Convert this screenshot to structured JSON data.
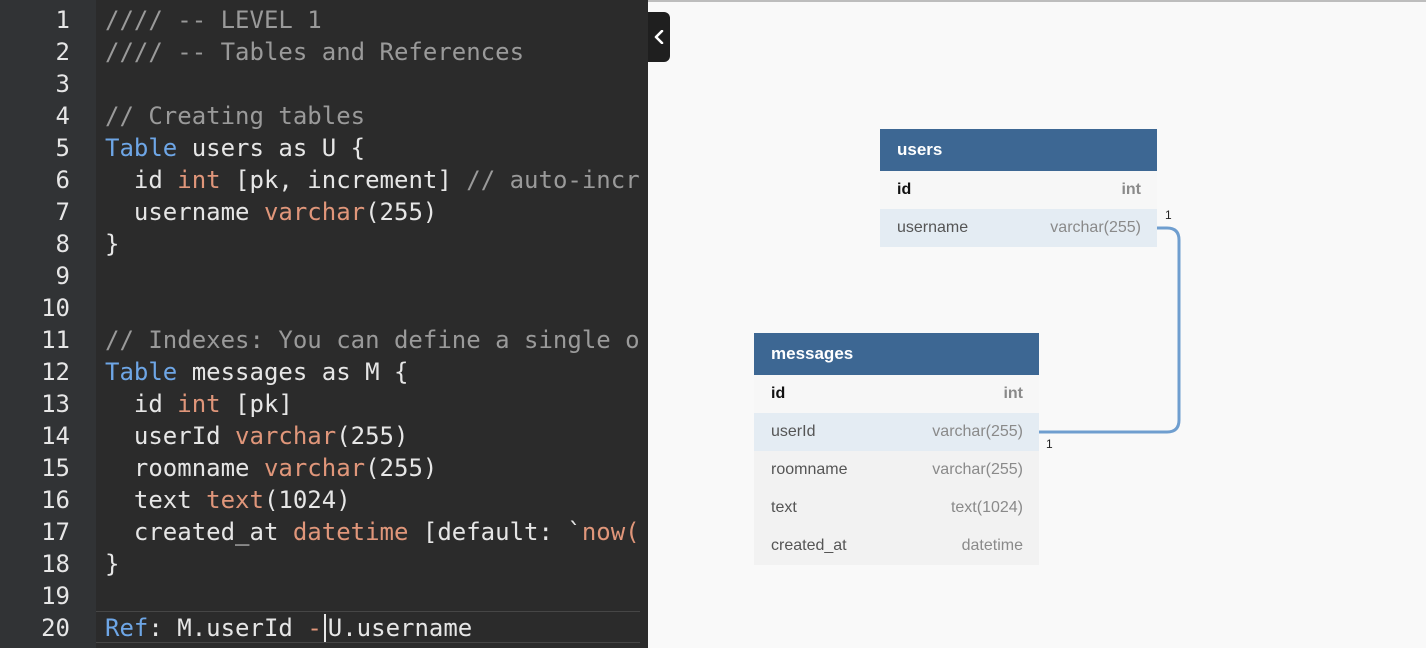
{
  "editor": {
    "lines": [
      {
        "n": "1",
        "seg": [
          {
            "t": "//// -- LEVEL 1",
            "c": "cm"
          }
        ]
      },
      {
        "n": "2",
        "seg": [
          {
            "t": "//// -- Tables and References",
            "c": "cm"
          }
        ]
      },
      {
        "n": "3",
        "seg": []
      },
      {
        "n": "4",
        "seg": [
          {
            "t": "// Creating tables",
            "c": "cm"
          }
        ]
      },
      {
        "n": "5",
        "seg": [
          {
            "t": "Table",
            "c": "kw"
          },
          {
            "t": " users as U {",
            "c": ""
          }
        ]
      },
      {
        "n": "6",
        "seg": [
          {
            "t": "  id ",
            "c": ""
          },
          {
            "t": "int",
            "c": "ty"
          },
          {
            "t": " [pk, increment] ",
            "c": ""
          },
          {
            "t": "// auto-incre",
            "c": "cm"
          }
        ]
      },
      {
        "n": "7",
        "seg": [
          {
            "t": "  username ",
            "c": ""
          },
          {
            "t": "varchar",
            "c": "ty"
          },
          {
            "t": "(255)",
            "c": ""
          }
        ]
      },
      {
        "n": "8",
        "seg": [
          {
            "t": "}",
            "c": ""
          }
        ]
      },
      {
        "n": "9",
        "seg": []
      },
      {
        "n": "10",
        "seg": []
      },
      {
        "n": "11",
        "seg": [
          {
            "t": "// Indexes: You can define a single o",
            "c": "cm"
          }
        ]
      },
      {
        "n": "12",
        "seg": [
          {
            "t": "Table",
            "c": "kw"
          },
          {
            "t": " messages as M {",
            "c": ""
          }
        ]
      },
      {
        "n": "13",
        "seg": [
          {
            "t": "  id ",
            "c": ""
          },
          {
            "t": "int",
            "c": "ty"
          },
          {
            "t": " [pk]",
            "c": ""
          }
        ]
      },
      {
        "n": "14",
        "seg": [
          {
            "t": "  userId ",
            "c": ""
          },
          {
            "t": "varchar",
            "c": "ty"
          },
          {
            "t": "(255)",
            "c": ""
          }
        ]
      },
      {
        "n": "15",
        "seg": [
          {
            "t": "  roomname ",
            "c": ""
          },
          {
            "t": "varchar",
            "c": "ty"
          },
          {
            "t": "(255)",
            "c": ""
          }
        ]
      },
      {
        "n": "16",
        "seg": [
          {
            "t": "  text ",
            "c": ""
          },
          {
            "t": "text",
            "c": "ty"
          },
          {
            "t": "(1024)",
            "c": ""
          }
        ]
      },
      {
        "n": "17",
        "seg": [
          {
            "t": "  created_at ",
            "c": ""
          },
          {
            "t": "datetime",
            "c": "ty"
          },
          {
            "t": " [default: `",
            "c": ""
          },
          {
            "t": "now(",
            "c": "ty"
          }
        ]
      },
      {
        "n": "18",
        "seg": [
          {
            "t": "}",
            "c": ""
          }
        ]
      },
      {
        "n": "19",
        "seg": []
      },
      {
        "n": "20",
        "active": true,
        "seg": [
          {
            "t": "Ref",
            "c": "kw"
          },
          {
            "t": ": M.userId ",
            "c": ""
          },
          {
            "t": "-",
            "c": "ty"
          },
          {
            "t": "|CARET|",
            "c": ""
          },
          {
            "t": "U.username",
            "c": ""
          }
        ]
      }
    ]
  },
  "diagram": {
    "tables": [
      {
        "key": "users",
        "name": "users",
        "fields": [
          {
            "name": "id",
            "type": "int",
            "pk": true
          },
          {
            "name": "username",
            "type": "varchar(255)",
            "highlight": true
          }
        ]
      },
      {
        "key": "messages",
        "name": "messages",
        "fields": [
          {
            "name": "id",
            "type": "int",
            "pk": true
          },
          {
            "name": "userId",
            "type": "varchar(255)",
            "highlight": true
          },
          {
            "name": "roomname",
            "type": "varchar(255)"
          },
          {
            "name": "text",
            "type": "text(1024)"
          },
          {
            "name": "created_at",
            "type": "datetime"
          }
        ]
      }
    ],
    "relation": {
      "from_label": "1",
      "to_label": "1",
      "color": "#6f9ecf"
    }
  },
  "colors": {
    "editor_bg": "#2b2b2b",
    "keyword": "#6ea6e6",
    "type": "#e0967a",
    "comment": "#9a9a9a",
    "table_header": "#3d6793"
  },
  "icons": {
    "collapse": "chevron-left-icon"
  }
}
